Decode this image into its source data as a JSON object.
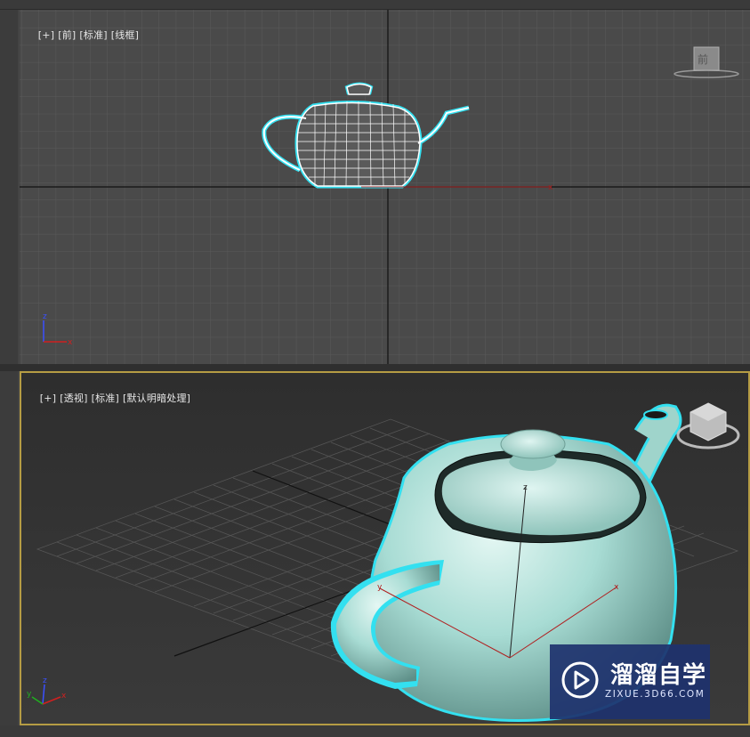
{
  "top_viewport": {
    "label_items": [
      "[+]",
      "[前]",
      "[标准]",
      "[线框]"
    ],
    "viewcube_face": "前"
  },
  "bottom_viewport": {
    "label_items": [
      "[+]",
      "[透视]",
      "[标准]",
      "[默认明暗处理]"
    ]
  },
  "axes": {
    "x": "x",
    "y": "y",
    "z": "z"
  },
  "watermark": {
    "title": "溜溜自学",
    "url": "ZIXUE.3D66.COM"
  },
  "colors": {
    "selection": "#33e0f0",
    "teapot_shaded": "#a8dcd4",
    "active_border": "#b59c44"
  }
}
